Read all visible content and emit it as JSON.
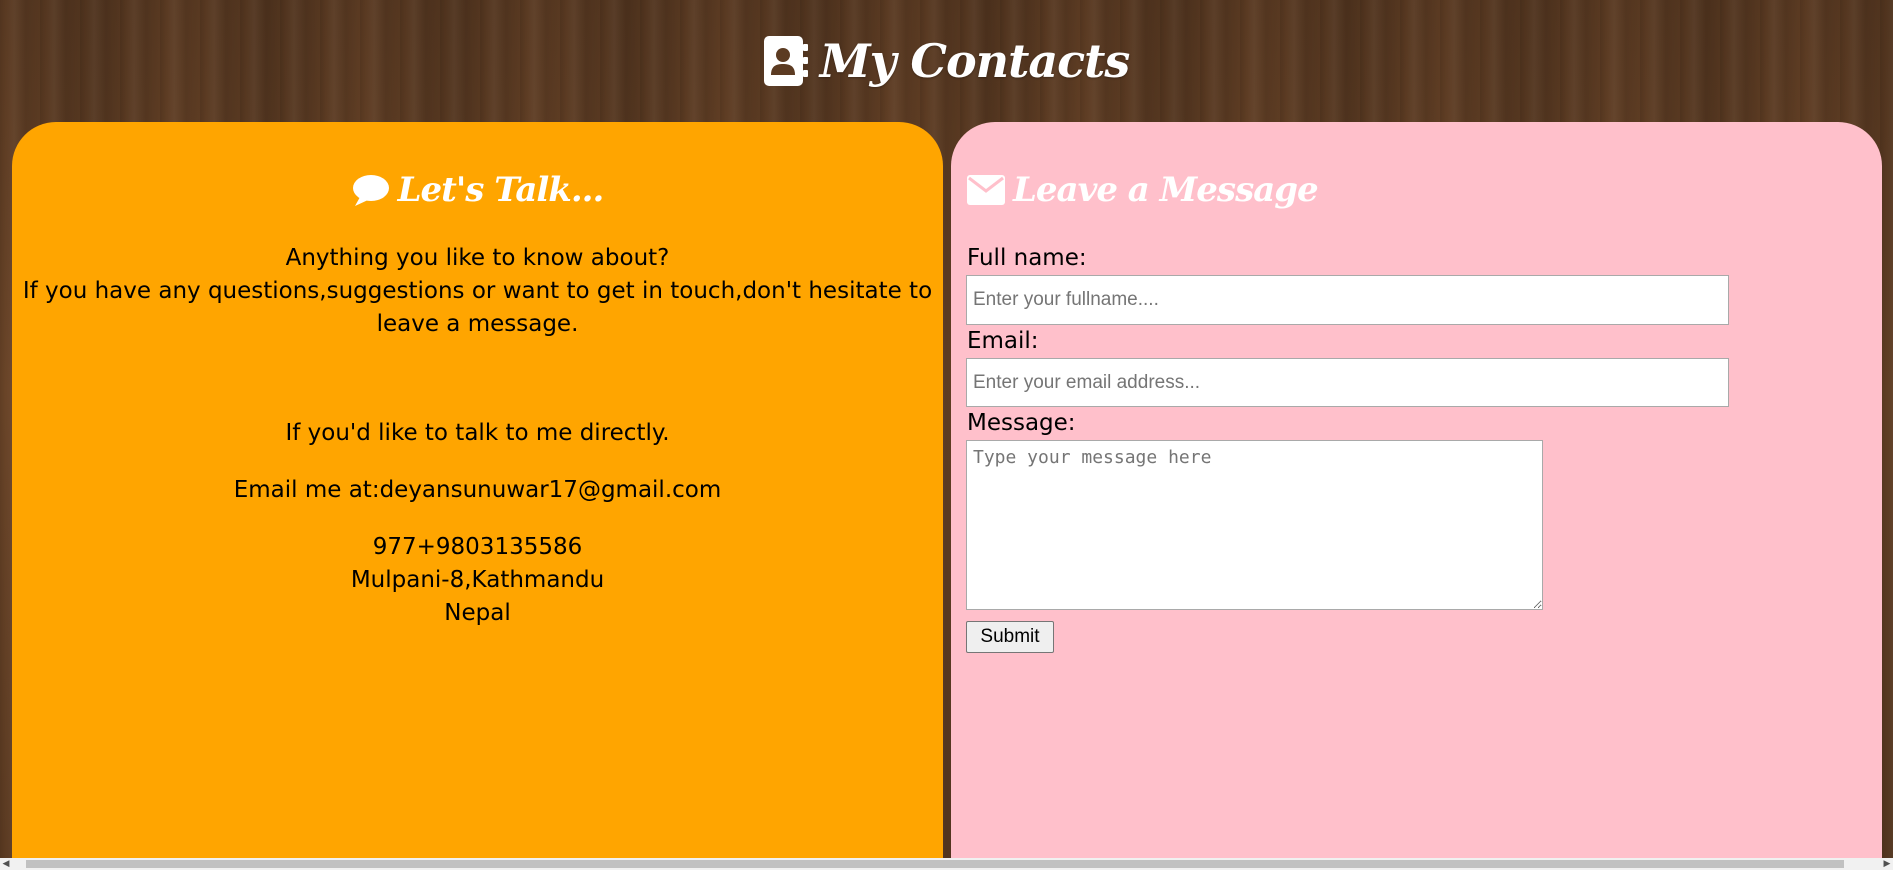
{
  "header": {
    "title": "My Contacts",
    "icon": "address-book-icon"
  },
  "left_panel": {
    "heading": "Let's Talk...",
    "heading_icon": "comment-icon",
    "intro_line1": "Anything you like to know about?",
    "intro_line2": "If you have any questions,suggestions or want to get in touch,don't hesitate to",
    "intro_line3": "leave a message.",
    "direct_text": "If you'd like to talk to me directly.",
    "email_text": "Email me at:deyansunuwar17@gmail.com",
    "phone": "977+9803135586",
    "address_line1": "Mulpani-8,Kathmandu",
    "address_line2": "Nepal",
    "background_color": "#ffa500"
  },
  "right_panel": {
    "heading": "Leave a Message",
    "heading_icon": "envelope-icon",
    "fullname_label": "Full name:",
    "fullname_placeholder": "Enter your fullname....",
    "fullname_value": "",
    "email_label": "Email:",
    "email_placeholder": "Enter your email address...",
    "email_value": "",
    "message_label": "Message:",
    "message_placeholder": "Type your message here",
    "message_value": "",
    "submit_label": "Submit",
    "background_color": "#ffc0cb"
  }
}
